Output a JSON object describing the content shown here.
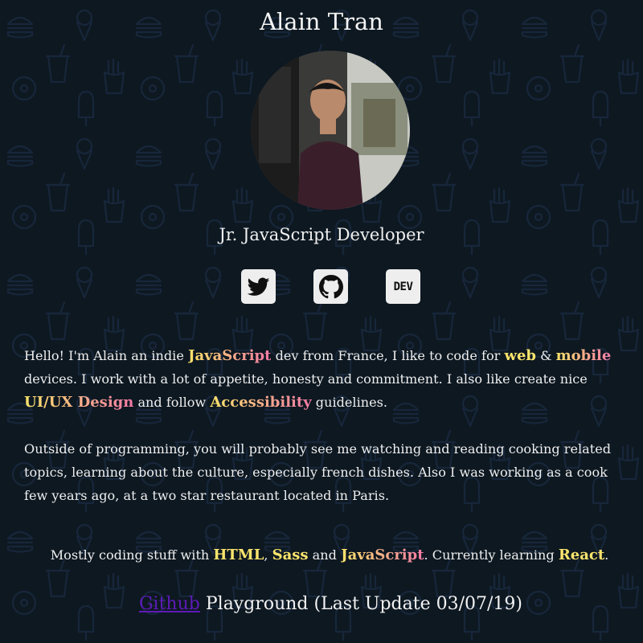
{
  "profile": {
    "name": "Alain Tran",
    "title": "Jr. JavaScript Developer",
    "avatar_icon": "avatar-photo"
  },
  "social": {
    "twitter_icon": "twitter-icon",
    "github_icon": "github-icon",
    "dev_label": "DEV"
  },
  "about": {
    "p1": {
      "t1": "Hello! I'm Alain an indie ",
      "h1": "JavaScript",
      "t2": " dev from France, I like to code for ",
      "h2": "web",
      "t3": " & ",
      "h3": "mobile",
      "t4": " devices. I work with a lot of appetite, honesty and commitment. I also like create nice ",
      "h4": "UI/UX Design",
      "t5": " and follow ",
      "h5": "Accessibility",
      "t6": " guidelines."
    },
    "p2": "Outside of programming, you will probably see me watching and reading cooking related topics, learning about the culture, especially french dishes. Also I was working as a cook few years ago, at a two star restaurant located in Paris."
  },
  "stack": {
    "t1": "Mostly coding stuff with ",
    "h1": "HTML",
    "t2": ", ",
    "h2": "Sass",
    "t3": " and ",
    "h3": "JavaScript",
    "t4": ". Currently learning ",
    "h4": "React",
    "t5": "."
  },
  "footer": {
    "link": "Github",
    "text": " Playground (Last Update 03/07/19)"
  },
  "colors": {
    "background": "#0d1821",
    "pattern": "#17263a",
    "highlight_yellow": "#fce46c",
    "highlight_pink": "#f07fa3",
    "link": "#5e1ab8"
  }
}
